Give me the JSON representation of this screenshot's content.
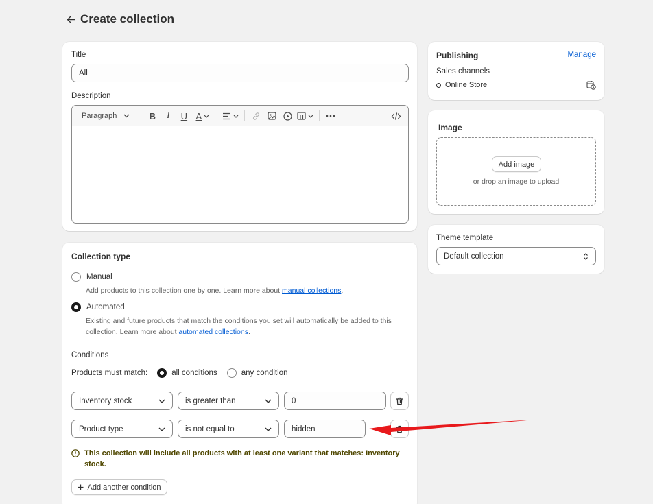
{
  "header": {
    "title": "Create collection"
  },
  "title_field": {
    "label": "Title",
    "value": "All"
  },
  "description": {
    "label": "Description",
    "toolbar": {
      "format_label": "Paragraph"
    }
  },
  "collection_type": {
    "heading": "Collection type",
    "manual": {
      "label": "Manual",
      "help": "Add products to this collection one by one. Learn more about ",
      "link": "manual collections",
      "help_end": "."
    },
    "automated": {
      "label": "Automated",
      "help": "Existing and future products that match the conditions you set will automatically be added to this collection. Learn more about ",
      "link": "automated collections",
      "help_end": "."
    },
    "conditions_heading": "Conditions",
    "match_label": "Products must match:",
    "match_all": "all conditions",
    "match_any": "any condition",
    "conditions": [
      {
        "field": "Inventory stock",
        "operator": "is greater than",
        "value": "0"
      },
      {
        "field": "Product type",
        "operator": "is not equal to",
        "value": "hidden"
      }
    ],
    "warning": "This collection will include all products with at least one variant that matches: Inventory stock.",
    "add_condition": "Add another condition"
  },
  "publishing": {
    "heading": "Publishing",
    "manage": "Manage",
    "sales_channels": "Sales channels",
    "channel": "Online Store"
  },
  "image": {
    "heading": "Image",
    "add_button": "Add image",
    "drop_text": "or drop an image to upload"
  },
  "theme": {
    "label": "Theme template",
    "value": "Default collection"
  },
  "colors": {
    "link": "#005bd3",
    "warning_text": "#4f4700",
    "annotation_arrow": "#e8191c"
  }
}
